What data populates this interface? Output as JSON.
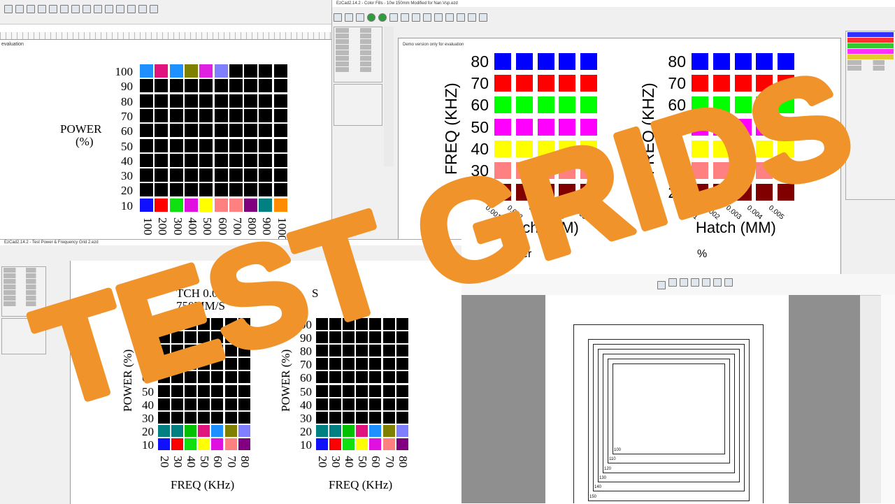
{
  "banner": {
    "text": "TEST GRIDS",
    "color": "#f0932b"
  },
  "windows": {
    "top_right": {
      "title": "EzCad2.14.2 - Color Fills - 10w 150mm Modified for Nan.Vsp.ezd",
      "canvas_note": "Demo version only for evaluation"
    },
    "bottom_left": {
      "title": "EzCad2.14.2 - Test Power & Frequency Grid 2.ezd"
    },
    "top_left": {
      "canvas_note": "evaluation"
    }
  },
  "grid_top_left": {
    "y_title_line1": "POWER",
    "y_title_line2": "(%)",
    "y_ticks": [
      "100",
      "90",
      "80",
      "70",
      "60",
      "50",
      "40",
      "30",
      "20",
      "10"
    ],
    "x_ticks": [
      "100",
      "200",
      "300",
      "400",
      "500",
      "600",
      "700",
      "800",
      "900",
      "1000"
    ],
    "top_row_colors": [
      "#1e90ff",
      "#e0137f",
      "#1e90ff",
      "#808000",
      "#e020e0",
      "#8080ff",
      "#000000",
      "#000000",
      "#000000",
      "#000000"
    ],
    "bottom_row_colors": [
      "#1010ff",
      "#ff0000",
      "#10e010",
      "#e010e0",
      "#ffff00",
      "#ff8080",
      "#ff8080",
      "#800080",
      "#008080",
      "#ff8c00"
    ],
    "fill_color": "#000000"
  },
  "grid_top_right_a": {
    "y_title": "FREQ (KHZ)",
    "y_ticks": [
      "80",
      "70",
      "60",
      "50",
      "40",
      "30",
      "20"
    ],
    "x_ticks": [
      "0.001",
      "0.002",
      "0.003",
      "0.004",
      "0.005"
    ],
    "x_title": "Hatch (MM)",
    "row_colors": [
      "#0000ff",
      "#ff0000",
      "#00ff00",
      "#ff00ff",
      "#ffff00",
      "#ff8080",
      "#800000"
    ],
    "footer": "Power"
  },
  "grid_top_right_b": {
    "y_title": "FREQ (KHZ)",
    "y_ticks": [
      "80",
      "70",
      "60",
      "50",
      "40",
      "30",
      "20"
    ],
    "x_ticks": [
      "0.001",
      "0.002",
      "0.003",
      "0.004",
      "0.005"
    ],
    "x_title": "Hatch (MM)",
    "row_colors": [
      "#0000ff",
      "#ff0000",
      "#00ff00",
      "#ff00ff",
      "#ffff00",
      "#ff8080",
      "#800000"
    ],
    "footer": "%"
  },
  "grid_bottom_a": {
    "header_line1": "TCH 0.05",
    "header_line2": "750MM/S",
    "y_title": "POWER (%)",
    "y_ticks": [
      "100",
      "90",
      "80",
      "70",
      "60",
      "50",
      "40",
      "30",
      "20",
      "10"
    ],
    "x_ticks": [
      "20",
      "30",
      "40",
      "50",
      "60",
      "70",
      "80"
    ],
    "x_title": "FREQ (KHz)",
    "row20_colors": [
      "#008080",
      "#008080",
      "#00c000",
      "#e0137f",
      "#1e90ff",
      "#808000",
      "#8080ff"
    ],
    "row10_colors": [
      "#1010ff",
      "#ff0000",
      "#10e010",
      "#ffff00",
      "#e010e0",
      "#ff8080",
      "#800080"
    ]
  },
  "grid_bottom_b": {
    "header_line1": "S",
    "y_title": "POWER (%)",
    "y_ticks": [
      "100",
      "90",
      "80",
      "70",
      "60",
      "50",
      "40",
      "30",
      "20",
      "10"
    ],
    "x_ticks": [
      "20",
      "30",
      "40",
      "50",
      "60",
      "70",
      "80"
    ],
    "x_title": "FREQ (KHz)",
    "row20_colors": [
      "#008080",
      "#008080",
      "#00c000",
      "#e0137f",
      "#1e90ff",
      "#808000",
      "#8080ff"
    ],
    "row10_colors": [
      "#1010ff",
      "#ff0000",
      "#10e010",
      "#ffff00",
      "#e010e0",
      "#ff8080",
      "#800080"
    ]
  },
  "nested_squares": {
    "labels": [
      "100",
      "110",
      "120",
      "130",
      "140",
      "150"
    ]
  }
}
